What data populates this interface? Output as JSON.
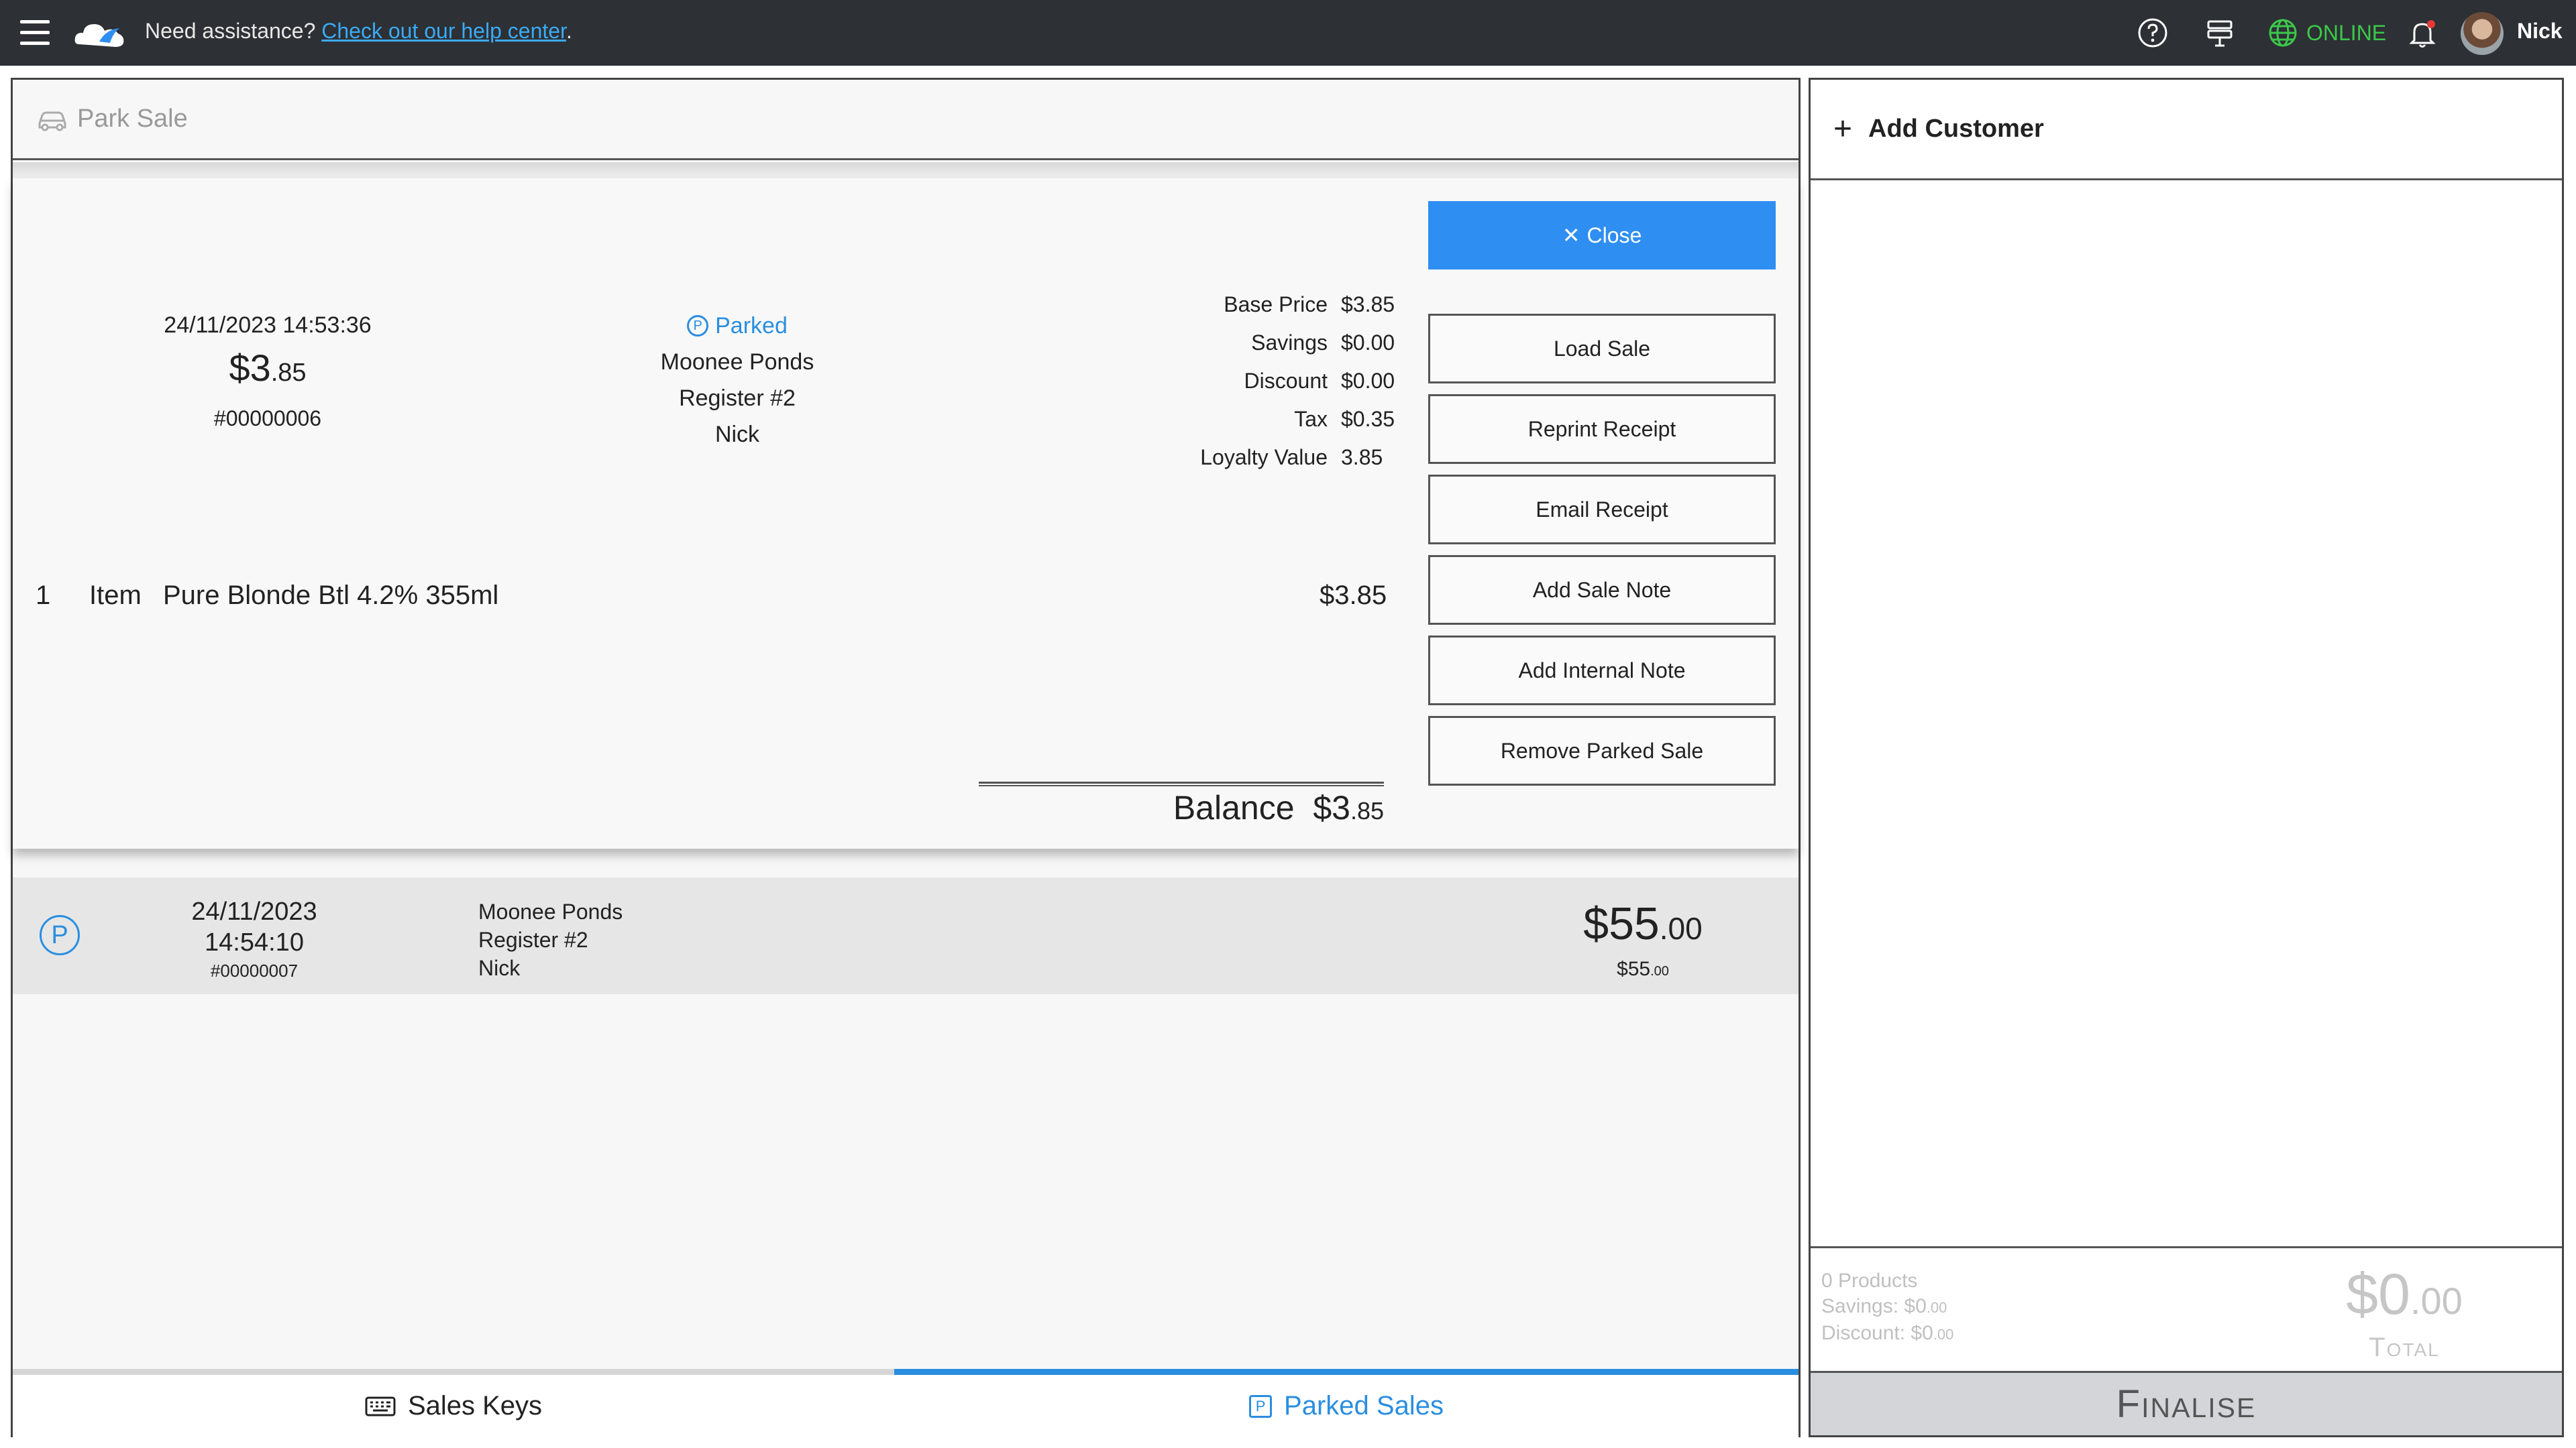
{
  "topbar": {
    "assist_text": "Need assistance?",
    "help_link": "Check out our help center",
    "help_period": ".",
    "status": "ONLINE",
    "user": "Nick",
    "status_color": "#3cc84a",
    "icons": [
      "menu-icon",
      "cloud-logo",
      "help-icon",
      "register-icon",
      "globe-icon",
      "bell-icon",
      "avatar"
    ]
  },
  "park_bar": {
    "label": "Park Sale",
    "icon": "car-icon"
  },
  "selected_sale": {
    "datetime": "24/11/2023 14:53:36",
    "amount_main": "$3",
    "amount_cents": ".85",
    "receipt_no": "#00000006",
    "status": "Parked",
    "location": "Moonee Ponds",
    "register": "Register #2",
    "staff": "Nick",
    "summary": [
      {
        "label": "Base Price",
        "value": "$3.85"
      },
      {
        "label": "Savings",
        "value": "$0.00"
      },
      {
        "label": "Discount",
        "value": "$0.00"
      },
      {
        "label": "Tax",
        "value": "$0.35"
      },
      {
        "label": "Loyalty Value",
        "value": "3.85"
      }
    ],
    "line_item": {
      "qty": "1",
      "type": "Item",
      "name": "Pure Blonde Btl 4.2% 355ml",
      "price": "$3.85"
    },
    "balance_label": "Balance",
    "balance_main": "$3",
    "balance_cents": ".85",
    "buttons": {
      "close": "Close",
      "load": "Load Sale",
      "reprint": "Reprint Receipt",
      "email": "Email Receipt",
      "add_sale_note": "Add Sale Note",
      "add_internal_note": "Add Internal Note",
      "remove": "Remove Parked Sale"
    }
  },
  "other_sale": {
    "date": "24/11/2023",
    "time": "14:54:10",
    "receipt_no": "#00000007",
    "location": "Moonee Ponds",
    "register": "Register #2",
    "staff": "Nick",
    "total_main": "$55",
    "total_cents": ".00",
    "sub_main": "$55",
    "sub_cents": ".00"
  },
  "tabs": {
    "sales_keys": "Sales Keys",
    "parked_sales": "Parked Sales",
    "active": "parked_sales"
  },
  "right_panel": {
    "add_customer": "Add Customer",
    "products": "0 Products",
    "savings_label": "Savings: $0",
    "savings_cents": ".00",
    "discount_label": "Discount: $0",
    "discount_cents": ".00",
    "total_main": "$0",
    "total_cents": ".00",
    "total_label": "Total",
    "finalise": "Finalise"
  },
  "colors": {
    "accent": "#2e8ef2",
    "topbar": "#2d3034",
    "online": "#3cc84a"
  }
}
